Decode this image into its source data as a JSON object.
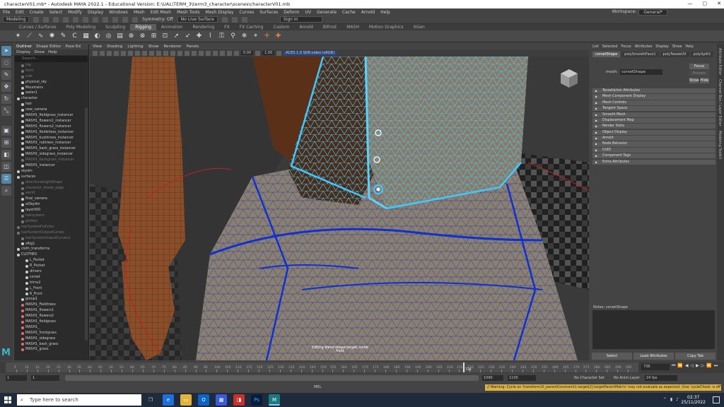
{
  "window": {
    "title": "characterV01.mb* - Autodesk MAYA 2022.1 - Educational Version: E:\\UAL\\TERM_3\\term3_character\\scenes\\characterV01.mb"
  },
  "menubar": {
    "items": [
      "File",
      "Edit",
      "Create",
      "Select",
      "Modify",
      "Display",
      "Windows",
      "Mesh",
      "Edit Mesh",
      "Mesh Tools",
      "Mesh Display",
      "Curves",
      "Surfaces",
      "Deform",
      "UV",
      "Generate",
      "Cache",
      "Arnold",
      "Help"
    ],
    "workspace_label": "Workspace:",
    "workspace_value": "General*"
  },
  "statusline": {
    "mode": "Modeling",
    "symmetry": "Symmetry: Off",
    "live_surface": "No Live Surface",
    "sign_in": "Sign In"
  },
  "shelf": {
    "tabs": [
      "Curves / Surfaces",
      "Poly Modeling",
      "Sculpting",
      "Rigging",
      "Animation",
      "Rendering",
      "FX",
      "FX Caching",
      "Custom",
      "Arnold",
      "Bifrost",
      "MASH",
      "Motion Graphics",
      "XGen"
    ],
    "active_tab": "Rigging"
  },
  "outliner": {
    "tabs": [
      "Outliner",
      "Shape Editor",
      "Pose Ed"
    ],
    "menu": [
      "Display",
      "Show",
      "Help"
    ],
    "search_placeholder": "Search...",
    "items": [
      {
        "label": "top",
        "dim": true,
        "color": "#777777",
        "indent": 1
      },
      {
        "label": "front",
        "dim": true,
        "color": "#777777",
        "indent": 1
      },
      {
        "label": "side",
        "dim": true,
        "color": "#777777",
        "indent": 1
      },
      {
        "label": "physical_sky",
        "dim": false,
        "color": "#cccccc",
        "indent": 1
      },
      {
        "label": "Mountains",
        "dim": false,
        "color": "#cccccc",
        "indent": 1
      },
      {
        "label": "water1",
        "dim": false,
        "color": "#cccccc",
        "indent": 1
      },
      {
        "label": "character",
        "dim": false,
        "color": "#cccccc",
        "indent": 0
      },
      {
        "label": "hair",
        "dim": false,
        "color": "#cccccc",
        "indent": 1
      },
      {
        "label": "new_camera",
        "dim": false,
        "color": "#cccccc",
        "indent": 1
      },
      {
        "label": "MASH1_fieldgrass_instancer",
        "dim": false,
        "color": "#cccccc",
        "indent": 1
      },
      {
        "label": "MASH1_flowers1_instancer",
        "dim": false,
        "color": "#cccccc",
        "indent": 1
      },
      {
        "label": "MASH1_flowers2_instancer",
        "dim": false,
        "color": "#cccccc",
        "indent": 1
      },
      {
        "label": "MASH1_fieldsitess_instancer",
        "dim": false,
        "color": "#cccccc",
        "indent": 1
      },
      {
        "label": "MASH1_bushtrees_instancer",
        "dim": false,
        "color": "#cccccc",
        "indent": 1
      },
      {
        "label": "MASH1_rubtrees_instancer",
        "dim": false,
        "color": "#cccccc",
        "indent": 1
      },
      {
        "label": "MASH1_back_grass_instancer",
        "dim": false,
        "color": "#cccccc",
        "indent": 1
      },
      {
        "label": "MASH1_sidegrass_instancer",
        "dim": false,
        "color": "#cccccc",
        "indent": 1
      },
      {
        "label": "MASH1_backgrass_instancer",
        "dim": true,
        "color": "#777777",
        "indent": 1
      },
      {
        "label": "MASH1_instancer",
        "dim": false,
        "color": "#cccccc",
        "indent": 1
      },
      {
        "label": "skydm",
        "dim": false,
        "color": "#cccccc",
        "indent": 0
      },
      {
        "label": "surfaces",
        "dim": false,
        "color": "#cccccc",
        "indent": 0
      },
      {
        "label": "directionalLightShape",
        "dim": true,
        "color": "#777777",
        "indent": 1
      },
      {
        "label": "character_shade_edge",
        "dim": true,
        "color": "#777777",
        "indent": 1
      },
      {
        "label": "world",
        "dim": true,
        "color": "#777777",
        "indent": 1
      },
      {
        "label": "final_camera",
        "dim": false,
        "color": "#cccccc",
        "indent": 1
      },
      {
        "label": "aiSkydm",
        "dim": false,
        "color": "#cccccc",
        "indent": 1
      },
      {
        "label": "layer000",
        "dim": false,
        "color": "#cccccc",
        "indent": 1
      },
      {
        "label": "hairsystem",
        "dim": true,
        "color": "#777777",
        "indent": 1
      },
      {
        "label": "pfxHair",
        "dim": true,
        "color": "#777777",
        "indent": 1
      },
      {
        "label": "hairSystemFollicles",
        "dim": true,
        "color": "#777777",
        "indent": 0
      },
      {
        "label": "hairSystemOutputCurves",
        "dim": true,
        "color": "#777777",
        "indent": 0
      },
      {
        "label": "hairSystemOutputCurves1",
        "dim": true,
        "color": "#777777",
        "indent": 1
      },
      {
        "label": "sRig1",
        "dim": false,
        "color": "#cccccc",
        "indent": 1
      },
      {
        "label": "cloth_transforms",
        "dim": false,
        "color": "#cccccc",
        "indent": 0
      },
      {
        "label": "CLOTHES",
        "dim": false,
        "color": "#cccccc",
        "indent": 0
      },
      {
        "label": "L_Pocket",
        "dim": false,
        "color": "#cccccc",
        "indent": 2
      },
      {
        "label": "R_Pocket",
        "dim": false,
        "color": "#cccccc",
        "indent": 2
      },
      {
        "label": "drivers",
        "dim": false,
        "color": "#cccccc",
        "indent": 2
      },
      {
        "label": "corset",
        "dim": false,
        "color": "#cccccc",
        "indent": 2
      },
      {
        "label": "trims2",
        "dim": false,
        "color": "#cccccc",
        "indent": 2
      },
      {
        "label": "L_Front",
        "dim": false,
        "color": "#cccccc",
        "indent": 2
      },
      {
        "label": "R_Front",
        "dim": false,
        "color": "#cccccc",
        "indent": 2
      },
      {
        "label": "group1",
        "dim": false,
        "color": "#cccccc",
        "indent": 1
      },
      {
        "label": "MASH1_Fieldtrees",
        "dim": false,
        "color": "#e07070",
        "indent": 1
      },
      {
        "label": "MASH1_flowers1",
        "dim": false,
        "color": "#e07070",
        "indent": 1
      },
      {
        "label": "MASH1_flowers2",
        "dim": false,
        "color": "#e07070",
        "indent": 1
      },
      {
        "label": "MASH1_fieldgrass",
        "dim": false,
        "color": "#e07070",
        "indent": 1
      },
      {
        "label": "MASH1_",
        "dim": false,
        "color": "#e07070",
        "indent": 1
      },
      {
        "label": "MASH1_frontgrass",
        "dim": false,
        "color": "#e07070",
        "indent": 1
      },
      {
        "label": "MASH1_sidegrass",
        "dim": false,
        "color": "#e07070",
        "indent": 1
      },
      {
        "label": "MASH1_back_grass",
        "dim": false,
        "color": "#e07070",
        "indent": 1
      },
      {
        "label": "MASH1_grass",
        "dim": false,
        "color": "#e07070",
        "indent": 1
      }
    ]
  },
  "viewport": {
    "menu": [
      "View",
      "Shading",
      "Lighting",
      "Show",
      "Renderer",
      "Panels"
    ],
    "field1": "0.00",
    "field2": "1.00",
    "colorspace": "ACES 1.0 SDR-video (sRGB)",
    "hud_line1": "Editing blend shape target: smile",
    "hud_line2": "front"
  },
  "attribute_editor": {
    "menu": [
      "List",
      "Selected",
      "Focus",
      "Attributes",
      "Display",
      "Show",
      "Help"
    ],
    "tabs": [
      "corsetShape",
      "polySmoothFace1",
      "polyTweakUV",
      "polySplit1"
    ],
    "mesh_label": "mesh:",
    "mesh_value": "corsetShape",
    "focus_button": "Focus",
    "presets_button": "Presets",
    "show_button": "Show",
    "hide_button": "Hide",
    "sections": [
      "Tessellation Attributes",
      "Mesh Component Display",
      "Mesh Controls",
      "Tangent Space",
      "Smooth Mesh",
      "Displacement Map",
      "Render Stats",
      "Object Display",
      "Arnold",
      "Node Behavior",
      "UUID",
      "Component Tags",
      "Extra Attributes"
    ],
    "notes_label": "Notes: corsetShape",
    "bottom_buttons": [
      "Select",
      "Load Attributes",
      "Copy Tab"
    ]
  },
  "right_strip": [
    "Attribute Editor",
    "Channel Box / Layer Editor",
    "Modeling Toolkit"
  ],
  "timeslider": {
    "ticks": [
      5,
      10,
      15,
      20,
      25,
      30,
      35,
      40,
      45,
      50,
      55,
      60,
      65,
      70,
      75,
      80,
      85,
      90,
      95,
      100,
      105,
      110,
      115,
      120,
      125,
      130,
      135,
      140,
      145,
      150,
      155,
      160,
      165,
      170,
      175,
      180,
      185,
      190,
      195,
      200,
      205,
      210,
      215,
      220,
      225,
      230,
      235,
      240,
      245,
      250,
      255,
      260,
      265,
      270,
      275,
      280,
      285,
      290,
      295
    ],
    "current_frame": "736",
    "current_marker": "736"
  },
  "range": {
    "start": "1",
    "start2": "1",
    "end": "1090",
    "end2": "1100",
    "character_set": "No Character Set",
    "anim_layer": "No Anim Layer",
    "fps": "24 fps"
  },
  "cmdline": {
    "mel_label": "MEL",
    "warning": "// Warning: Cycle on 'transform10_parentConstraint1.target[2].targetParentMatrix' may not evaluate as expected. (Use 'cycleCheck -e off' to disable this warning."
  },
  "taskbar": {
    "search_placeholder": "Type here to search",
    "time": "02:37",
    "date": "25/11/2022"
  },
  "colors": {
    "accent": "#5285a6",
    "maya_logo": "#37b6c4",
    "warning_bg": "#d9b24a",
    "wire_cyan": "#41c8ff",
    "wire_blue": "#1030d0"
  }
}
